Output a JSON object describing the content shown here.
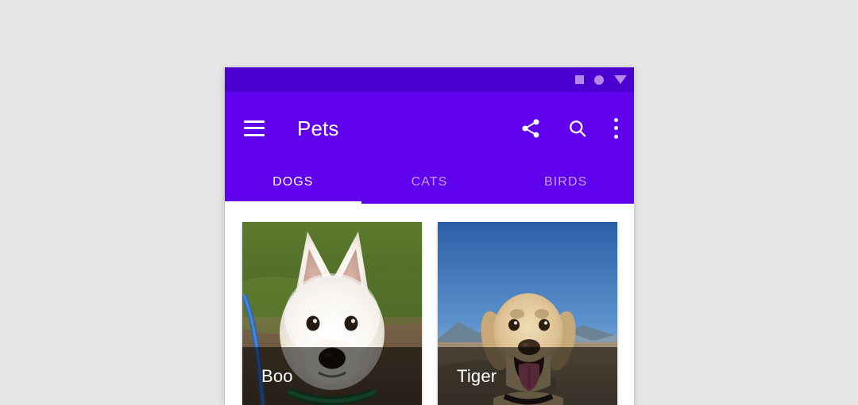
{
  "theme": {
    "page_background": "#E7E7E7",
    "primary": "#6002EE",
    "primary_dark": "#4B00D2",
    "on_primary": "#FFFFFF",
    "surface": "#FFFFFF",
    "scrim": "rgba(0,0,0,0.55)"
  },
  "status_bar": {
    "icons": [
      {
        "name": "square-indicator-icon",
        "glyph": "square"
      },
      {
        "name": "battery-circle-icon",
        "glyph": "circle"
      },
      {
        "name": "signal-triangle-icon",
        "glyph": "triangle-down"
      }
    ]
  },
  "app_bar": {
    "menu_label": "Menu",
    "title": "Pets",
    "actions": [
      {
        "name": "share-icon",
        "label": "Share"
      },
      {
        "name": "search-icon",
        "label": "Search"
      },
      {
        "name": "overflow-menu-icon",
        "label": "More options"
      }
    ]
  },
  "tabs": {
    "selected_index": 0,
    "items": [
      {
        "label": "DOGS",
        "active": true
      },
      {
        "label": "CATS",
        "active": false
      },
      {
        "label": "BIRDS",
        "active": false
      }
    ]
  },
  "content": {
    "cards": [
      {
        "name": "Boo",
        "photo_alt": "White terrier dog close-up on grass"
      },
      {
        "name": "Tiger",
        "photo_alt": "Tan labrador dog panting on a beach under blue sky"
      }
    ]
  }
}
